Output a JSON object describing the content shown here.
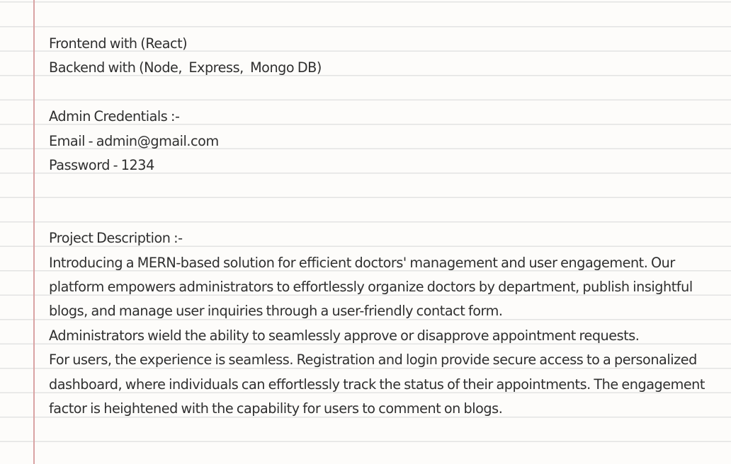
{
  "note": {
    "frontend": "Frontend with (React)",
    "backend": "Backend with (Node,  Express,  Mongo DB)",
    "admin_heading": "Admin Credentials :-",
    "email": "Email - admin@gmail.com",
    "password": "Password - 1234",
    "description_heading": "Project Description :-",
    "paragraphs": [
      "Introducing a MERN-based solution for efficient doctors' management and user engagement. Our platform empowers administrators to effortlessly organize doctors by department, publish insightful blogs, and manage user inquiries through a user-friendly contact form.",
      "Administrators wield the ability to seamlessly approve or disapprove appointment requests.",
      "For users, the experience is seamless. Registration and login provide secure access to a personalized dashboard, where individuals can effortlessly track the status of their appointments. The engagement factor is heightened with the capability for users to comment on blogs."
    ]
  }
}
